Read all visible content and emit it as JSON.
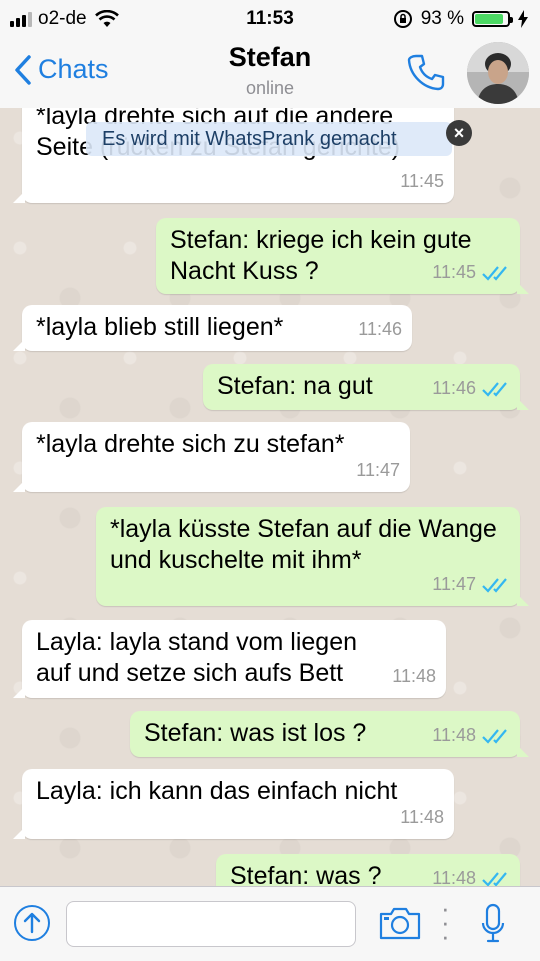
{
  "status": {
    "carrier": "o2-de",
    "time": "11:53",
    "battery": "93 %",
    "battery_level": 0.93
  },
  "header": {
    "back_label": "Chats",
    "contact_name": "Stefan",
    "contact_status": "online"
  },
  "banner": {
    "text": "Es wird mit WhatsPrank gemacht",
    "close": "×"
  },
  "messages": [
    {
      "dir": "in",
      "text": "*layla drehte sich auf die andere Seite (rücken zu Stefan gerichte)",
      "time": "11:45"
    },
    {
      "dir": "out",
      "text": "Stefan: kriege ich kein gute Nacht Kuss ?",
      "time": "11:45"
    },
    {
      "dir": "in",
      "text": "*layla blieb still liegen*",
      "time": "11:46"
    },
    {
      "dir": "out",
      "text": "Stefan: na gut",
      "time": "11:46"
    },
    {
      "dir": "in",
      "text": "*layla drehte sich zu stefan*",
      "time": "11:47"
    },
    {
      "dir": "out",
      "text": "*layla küsste Stefan auf die Wange und kuschelte mit ihm*",
      "time": "11:47"
    },
    {
      "dir": "in",
      "text": "Layla: layla stand vom liegen auf und setze sich aufs Bett",
      "time": "11:48"
    },
    {
      "dir": "out",
      "text": "Stefan: was ist los ?",
      "time": "11:48"
    },
    {
      "dir": "in",
      "text": "Layla: ich kann das einfach nicht",
      "time": "11:48"
    },
    {
      "dir": "out",
      "text": "Stefan: was ?",
      "time": "11:48"
    }
  ],
  "input": {
    "placeholder": ""
  },
  "colors": {
    "accent": "#1f7fe0",
    "out_bubble": "#dcf8c6",
    "in_bubble": "#ffffff",
    "ticks": "#34b7f1"
  }
}
